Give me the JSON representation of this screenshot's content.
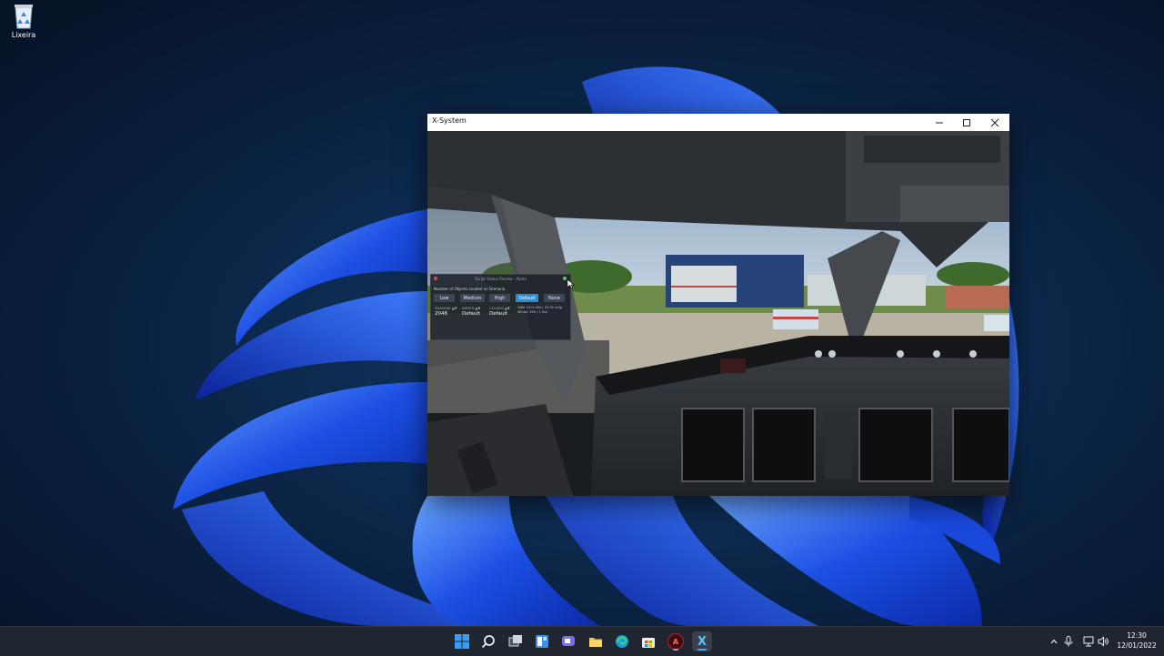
{
  "desktop": {
    "icons": [
      {
        "label": "Lixeira",
        "icon": "recycle-bin-icon"
      }
    ]
  },
  "window": {
    "title": "X-System",
    "controls": {
      "minimize": "minimize-icon",
      "maximize": "maximize-icon",
      "close": "close-icon"
    }
  },
  "overlay": {
    "title": "Script Status Review - Alpha",
    "objects_label": "Number of Objects Loaded on Scenario",
    "quality_buttons": [
      "Low",
      "Medium",
      "High",
      "Default",
      "None"
    ],
    "active_quality": "Default",
    "stats": [
      {
        "label": "SHADOW ▲▼",
        "value": "2048"
      },
      {
        "label": "WATER ▲▼",
        "value": "Default"
      },
      {
        "label": "CLOUDS ▲▼",
        "value": "Default"
      }
    ],
    "info_lines": [
      "QNH 1013 hPa | 29.92 inHg",
      "Winds: 350 / 1 Kts"
    ]
  },
  "taskbar": {
    "apps": [
      {
        "icon": "windows-start-icon"
      },
      {
        "icon": "search-icon"
      },
      {
        "icon": "task-view-icon"
      },
      {
        "icon": "widgets-icon"
      },
      {
        "icon": "teams-chat-icon"
      },
      {
        "icon": "file-explorer-icon"
      },
      {
        "icon": "edge-browser-icon"
      },
      {
        "icon": "store-icon"
      },
      {
        "icon": "app-red-a-icon",
        "label": "A"
      },
      {
        "icon": "x-system-app-icon",
        "label": "X",
        "active": true
      }
    ],
    "tray": {
      "icons": [
        "chevron-up-icon",
        "microphone-icon",
        "network-icon",
        "volume-icon"
      ]
    },
    "clock": {
      "time": "12:30",
      "date": "12/01/2022"
    }
  },
  "colors": {
    "accent": "#2a8ed6",
    "wallpaper_dark": "#07162b",
    "bloom_blue": "#1e57e8"
  }
}
